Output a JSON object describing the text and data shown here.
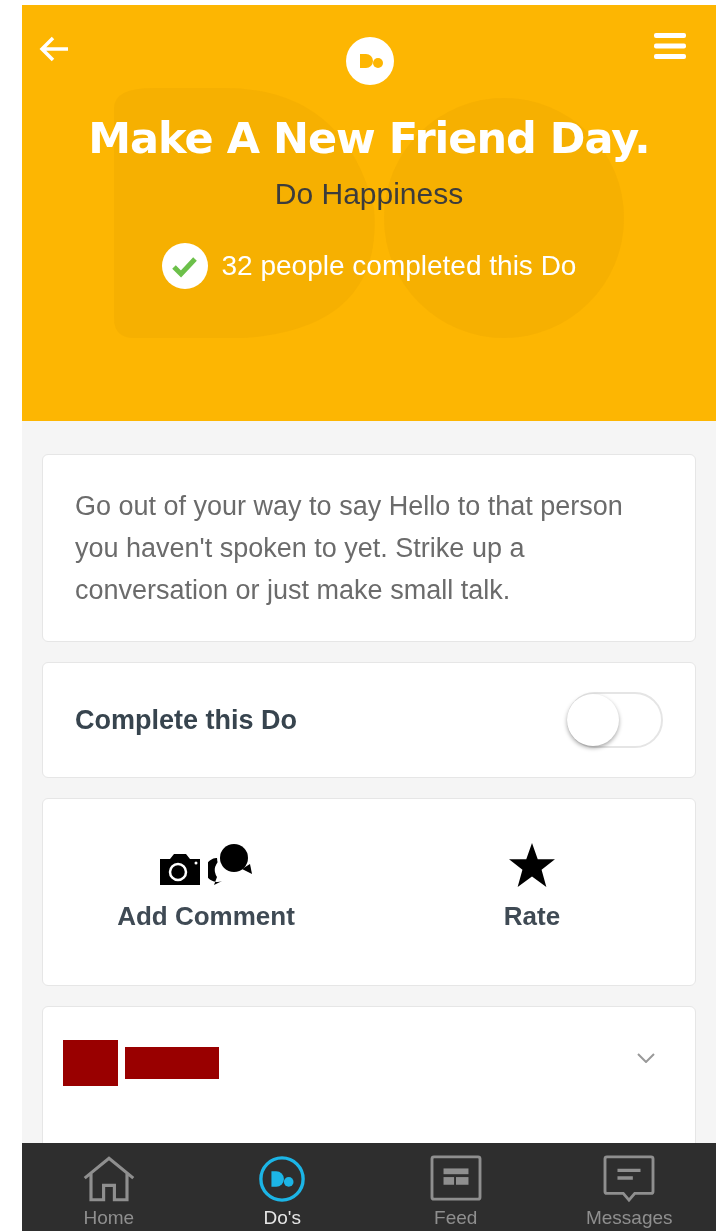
{
  "header": {
    "title": "Make A New Friend Day.",
    "category": "Do Happiness",
    "completed_text": "32 people completed this Do"
  },
  "description": "Go out of your way to say Hello to that person you haven't spoken to yet. Strike up a conversation or just make small talk.",
  "complete_toggle": {
    "label": "Complete this Do",
    "on": false
  },
  "actions": [
    {
      "kind": "comment",
      "label": "Add Comment"
    },
    {
      "kind": "rate",
      "label": "Rate"
    }
  ],
  "comment_card": {
    "expanded": false
  },
  "bottom_nav": [
    {
      "kind": "home",
      "label": "Home",
      "selected": false
    },
    {
      "kind": "dos",
      "label": "Do's",
      "selected": true
    },
    {
      "kind": "feed",
      "label": "Feed",
      "selected": false
    },
    {
      "kind": "messages",
      "label": "Messages",
      "selected": false
    }
  ]
}
